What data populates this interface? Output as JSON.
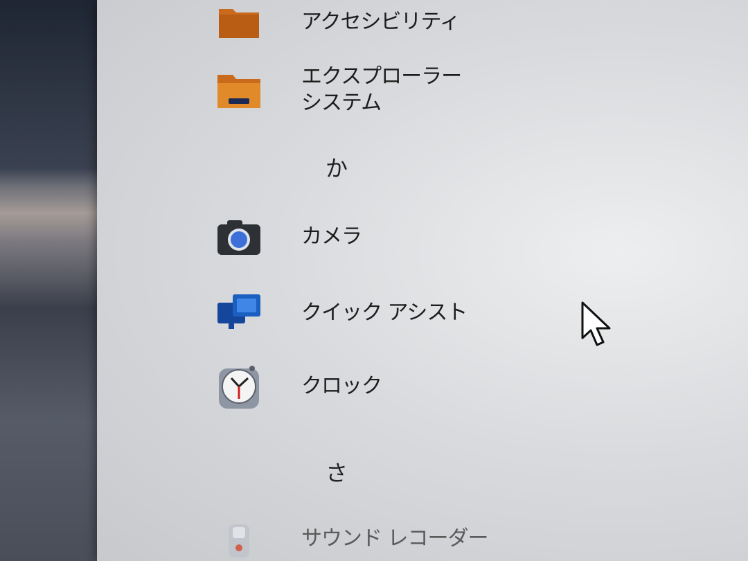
{
  "start_menu": {
    "apps": [
      {
        "label": "アクセシビリティ",
        "icon": "folder-icon"
      },
      {
        "label_line1": "エクスプローラー",
        "label_line2": "システム",
        "icon": "folder-icon"
      },
      {
        "group_letter": "か"
      },
      {
        "label": "カメラ",
        "icon": "camera-icon"
      },
      {
        "label": "クイック アシスト",
        "icon": "quick-assist-icon"
      },
      {
        "label": "クロック",
        "icon": "clock-icon"
      },
      {
        "group_letter": "さ"
      },
      {
        "label": "サウンド レコーダー",
        "icon": "sound-recorder-icon"
      }
    ]
  },
  "colors": {
    "folder": "#c96a1d",
    "camera_lens": "#3c6fd8",
    "quick_assist": "#1b5fc1",
    "clock_hand": "#d21f1f"
  }
}
